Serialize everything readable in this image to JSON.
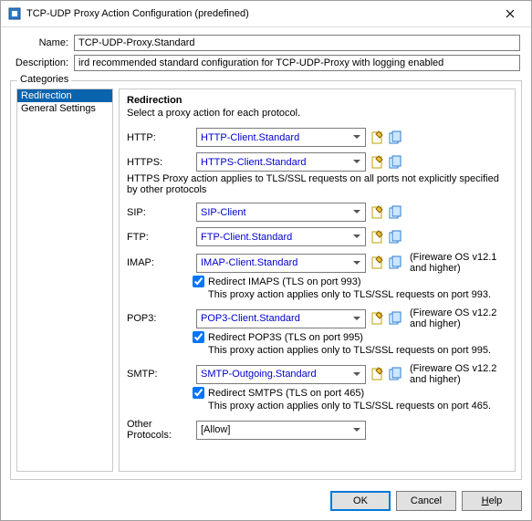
{
  "window": {
    "title": "TCP-UDP Proxy Action Configuration (predefined)"
  },
  "form": {
    "name_label": "Name:",
    "name_value": "TCP-UDP-Proxy.Standard",
    "description_label": "Description:",
    "description_value": "ird recommended standard configuration for TCP-UDP-Proxy with logging enabled"
  },
  "categories": {
    "legend": "Categories",
    "items": [
      "Redirection",
      "General Settings"
    ],
    "selected": "Redirection"
  },
  "panel": {
    "heading": "Redirection",
    "subtext": "Select a proxy action for each protocol.",
    "http": {
      "label": "HTTP:",
      "value": "HTTP-Client.Standard"
    },
    "https": {
      "label": "HTTPS:",
      "value": "HTTPS-Client.Standard"
    },
    "https_note": "HTTPS Proxy action applies to TLS/SSL requests on all ports not explicitly specified by other protocols",
    "sip": {
      "label": "SIP:",
      "value": "SIP-Client"
    },
    "ftp": {
      "label": "FTP:",
      "value": "FTP-Client.Standard"
    },
    "imap": {
      "label": "IMAP:",
      "value": "IMAP-Client.Standard",
      "side": "(Fireware OS v12.1 and higher)",
      "chk_label": "Redirect IMAPS (TLS on port 993)",
      "chk_note": "This proxy action applies only to TLS/SSL requests on port 993."
    },
    "pop3": {
      "label": "POP3:",
      "value": "POP3-Client.Standard",
      "side": "(Fireware OS v12.2 and higher)",
      "chk_label": "Redirect POP3S (TLS on port 995)",
      "chk_note": "This proxy action applies only to TLS/SSL requests on port 995."
    },
    "smtp": {
      "label": "SMTP:",
      "value": "SMTP-Outgoing.Standard",
      "side": "(Fireware OS v12.2 and higher)",
      "chk_label": "Redirect SMTPS (TLS on port 465)",
      "chk_note": "This proxy action applies only to TLS/SSL requests on port 465."
    },
    "other": {
      "label": "Other Protocols:",
      "value": "[Allow]"
    }
  },
  "buttons": {
    "ok": "OK",
    "cancel": "Cancel",
    "help": "Help"
  }
}
